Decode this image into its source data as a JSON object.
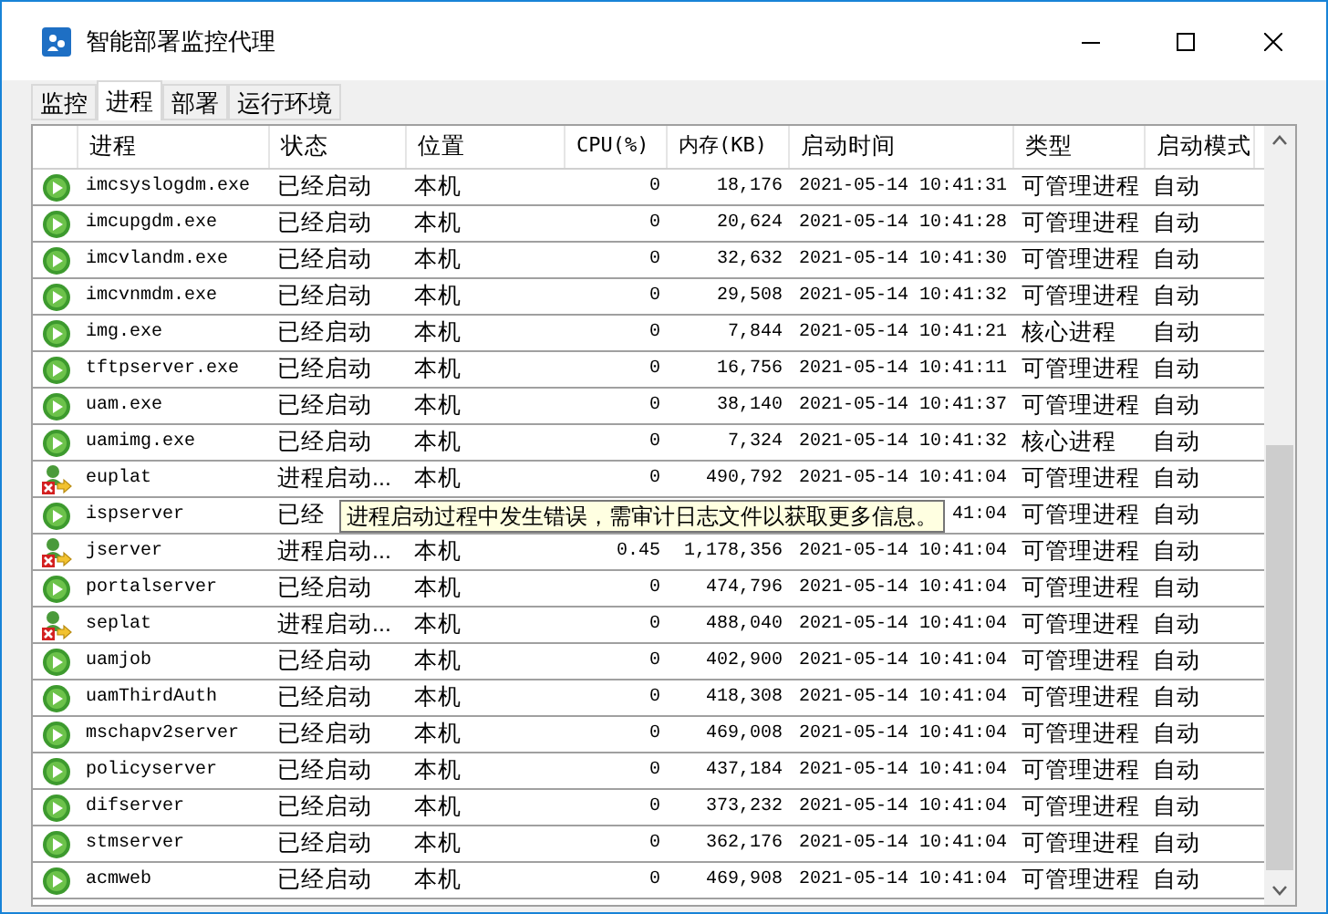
{
  "window": {
    "title": "智能部署监控代理"
  },
  "tabs": [
    {
      "label": "监控",
      "selected": false
    },
    {
      "label": "进程",
      "selected": true
    },
    {
      "label": "部署",
      "selected": false
    },
    {
      "label": "运行环境",
      "selected": false
    }
  ],
  "table": {
    "columns": [
      "进程",
      "状态",
      "位置",
      "CPU(%)",
      "内存(KB)",
      "启动时间",
      "类型",
      "启动模式"
    ],
    "rows": [
      {
        "kind": "running",
        "name": "imcsyslogdm.exe",
        "status": "已经启动",
        "location": "本机",
        "cpu": "0",
        "memory": "18,176",
        "time": "2021-05-14  10:41:31",
        "type": "可管理进程",
        "mode": "自动"
      },
      {
        "kind": "running",
        "name": "imcupgdm.exe",
        "status": "已经启动",
        "location": "本机",
        "cpu": "0",
        "memory": "20,624",
        "time": "2021-05-14  10:41:28",
        "type": "可管理进程",
        "mode": "自动"
      },
      {
        "kind": "running",
        "name": "imcvlandm.exe",
        "status": "已经启动",
        "location": "本机",
        "cpu": "0",
        "memory": "32,632",
        "time": "2021-05-14  10:41:30",
        "type": "可管理进程",
        "mode": "自动"
      },
      {
        "kind": "running",
        "name": "imcvnmdm.exe",
        "status": "已经启动",
        "location": "本机",
        "cpu": "0",
        "memory": "29,508",
        "time": "2021-05-14  10:41:32",
        "type": "可管理进程",
        "mode": "自动"
      },
      {
        "kind": "running",
        "name": "img.exe",
        "status": "已经启动",
        "location": "本机",
        "cpu": "0",
        "memory": "7,844",
        "time": "2021-05-14  10:41:21",
        "type": "核心进程",
        "mode": "自动"
      },
      {
        "kind": "running",
        "name": "tftpserver.exe",
        "status": "已经启动",
        "location": "本机",
        "cpu": "0",
        "memory": "16,756",
        "time": "2021-05-14  10:41:11",
        "type": "可管理进程",
        "mode": "自动"
      },
      {
        "kind": "running",
        "name": "uam.exe",
        "status": "已经启动",
        "location": "本机",
        "cpu": "0",
        "memory": "38,140",
        "time": "2021-05-14  10:41:37",
        "type": "可管理进程",
        "mode": "自动"
      },
      {
        "kind": "running",
        "name": "uamimg.exe",
        "status": "已经启动",
        "location": "本机",
        "cpu": "0",
        "memory": "7,324",
        "time": "2021-05-14  10:41:32",
        "type": "核心进程",
        "mode": "自动"
      },
      {
        "kind": "error",
        "name": "euplat",
        "status": "进程启动...",
        "location": "本机",
        "cpu": "0",
        "memory": "490,792",
        "time": "2021-05-14  10:41:04",
        "type": "可管理进程",
        "mode": "自动"
      },
      {
        "kind": "running",
        "name": "ispserver",
        "status": "已经",
        "time": "41:04",
        "type": "可管理进程",
        "mode": "自动"
      },
      {
        "kind": "error",
        "name": "jserver",
        "status": "进程启动...",
        "location": "本机",
        "cpu": "0.45",
        "memory": "1,178,356",
        "time": "2021-05-14  10:41:04",
        "type": "可管理进程",
        "mode": "自动"
      },
      {
        "kind": "running",
        "name": "portalserver",
        "status": "已经启动",
        "location": "本机",
        "cpu": "0",
        "memory": "474,796",
        "time": "2021-05-14  10:41:04",
        "type": "可管理进程",
        "mode": "自动"
      },
      {
        "kind": "error",
        "name": "seplat",
        "status": "进程启动...",
        "location": "本机",
        "cpu": "0",
        "memory": "488,040",
        "time": "2021-05-14  10:41:04",
        "type": "可管理进程",
        "mode": "自动"
      },
      {
        "kind": "running",
        "name": "uamjob",
        "status": "已经启动",
        "location": "本机",
        "cpu": "0",
        "memory": "402,900",
        "time": "2021-05-14  10:41:04",
        "type": "可管理进程",
        "mode": "自动"
      },
      {
        "kind": "running",
        "name": "uamThirdAuth",
        "status": "已经启动",
        "location": "本机",
        "cpu": "0",
        "memory": "418,308",
        "time": "2021-05-14  10:41:04",
        "type": "可管理进程",
        "mode": "自动"
      },
      {
        "kind": "running",
        "name": "mschapv2server",
        "status": "已经启动",
        "location": "本机",
        "cpu": "0",
        "memory": "469,008",
        "time": "2021-05-14  10:41:04",
        "type": "可管理进程",
        "mode": "自动"
      },
      {
        "kind": "running",
        "name": "policyserver",
        "status": "已经启动",
        "location": "本机",
        "cpu": "0",
        "memory": "437,184",
        "time": "2021-05-14  10:41:04",
        "type": "可管理进程",
        "mode": "自动"
      },
      {
        "kind": "running",
        "name": "difserver",
        "status": "已经启动",
        "location": "本机",
        "cpu": "0",
        "memory": "373,232",
        "time": "2021-05-14  10:41:04",
        "type": "可管理进程",
        "mode": "自动"
      },
      {
        "kind": "running",
        "name": "stmserver",
        "status": "已经启动",
        "location": "本机",
        "cpu": "0",
        "memory": "362,176",
        "time": "2021-05-14  10:41:04",
        "type": "可管理进程",
        "mode": "自动"
      },
      {
        "kind": "running",
        "name": "acmweb",
        "status": "已经启动",
        "location": "本机",
        "cpu": "0",
        "memory": "469,908",
        "time": "2021-05-14  10:41:04",
        "type": "可管理进程",
        "mode": "自动"
      }
    ]
  },
  "tooltip": {
    "text": "进程启动过程中发生错误，需审计日志文件以获取更多信息。"
  }
}
